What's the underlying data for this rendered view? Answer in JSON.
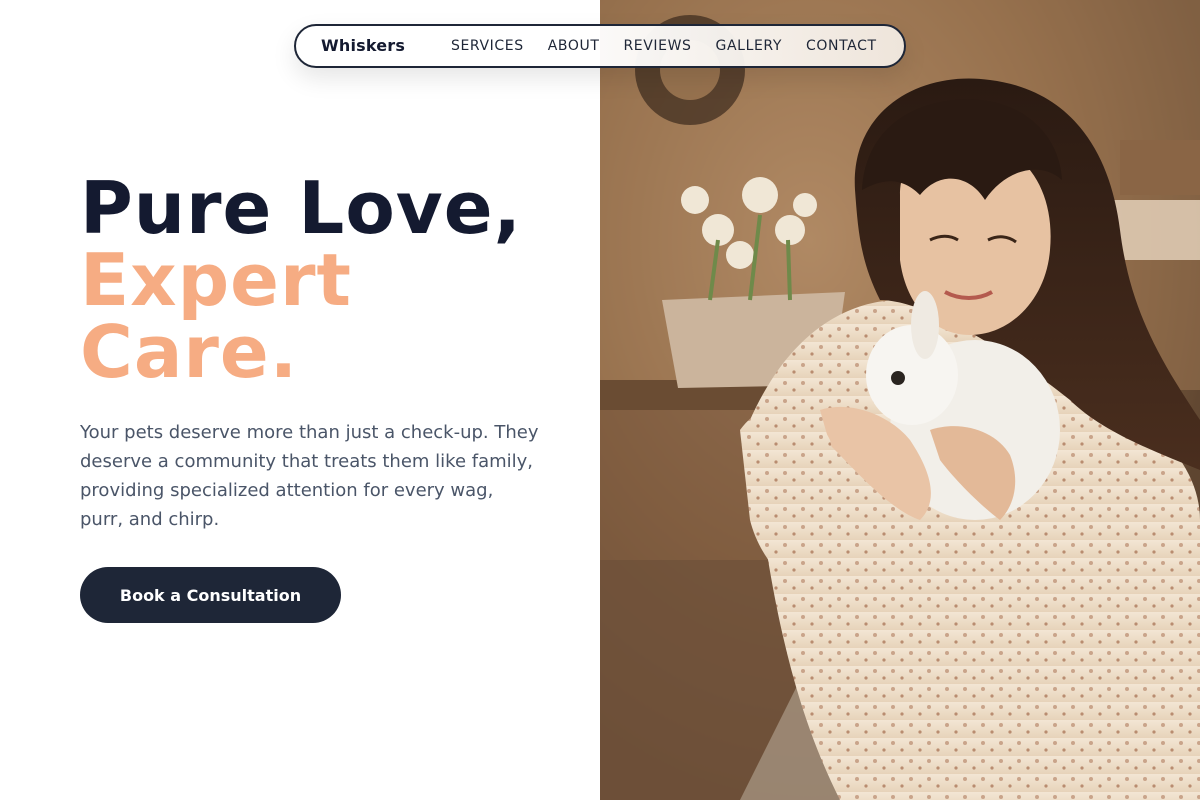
{
  "nav": {
    "brand": "Whiskers",
    "links": [
      "SERVICES",
      "ABOUT",
      "REVIEWS",
      "GALLERY",
      "CONTACT"
    ]
  },
  "hero": {
    "title_line1": "Pure Love,",
    "title_line2": "Expert",
    "title_line3": "Care.",
    "description": "Your pets deserve more than just a check-up. They deserve a community that treats them like family, providing specialized attention for every wag, purr, and chirp.",
    "cta_label": "Book a Consultation"
  },
  "colors": {
    "dark": "#141a30",
    "accent": "#f6ac83",
    "button": "#1e2637",
    "body_text": "#4a5568"
  },
  "photo": {
    "subject": "woman holding white rabbit"
  }
}
